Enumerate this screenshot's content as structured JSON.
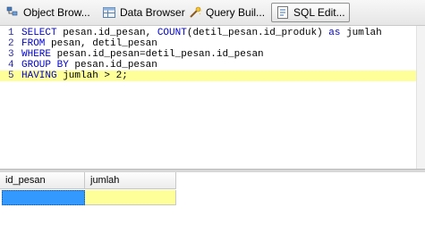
{
  "tabs": [
    {
      "label": "Object Brow...",
      "icon": "object-browser-icon"
    },
    {
      "label": "Data Browser",
      "icon": "data-browser-icon"
    },
    {
      "label": "Query Buil...",
      "icon": "query-builder-icon"
    },
    {
      "label": "SQL Edit...",
      "icon": "sql-editor-icon",
      "active": true
    }
  ],
  "editor": {
    "lines": [
      {
        "num": "1",
        "parts": [
          [
            "kw",
            "SELECT"
          ],
          [
            "t",
            " pesan.id_pesan, "
          ],
          [
            "kw",
            "COUNT"
          ],
          [
            "t",
            "(detil_pesan.id_produk) "
          ],
          [
            "kw",
            "as"
          ],
          [
            "t",
            " jumlah"
          ]
        ]
      },
      {
        "num": "2",
        "parts": [
          [
            "kw",
            "FROM"
          ],
          [
            "t",
            " pesan, detil_pesan"
          ]
        ]
      },
      {
        "num": "3",
        "parts": [
          [
            "kw",
            "WHERE"
          ],
          [
            "t",
            " pesan.id_pesan=detil_pesan.id_pesan"
          ]
        ]
      },
      {
        "num": "4",
        "parts": [
          [
            "kw",
            "GROUP BY"
          ],
          [
            "t",
            " pesan.id_pesan"
          ]
        ]
      },
      {
        "num": "5",
        "parts": [
          [
            "kw",
            "HAVING"
          ],
          [
            "t",
            " jumlah > 2;"
          ]
        ]
      }
    ],
    "current_line": 5
  },
  "grid": {
    "columns": [
      "id_pesan",
      "jumlah"
    ],
    "rows": [
      [
        "",
        ""
      ]
    ]
  },
  "colors": {
    "keyword": "#0000cc",
    "current_line": "#ffff99",
    "selected_cell": "#3399ff"
  }
}
